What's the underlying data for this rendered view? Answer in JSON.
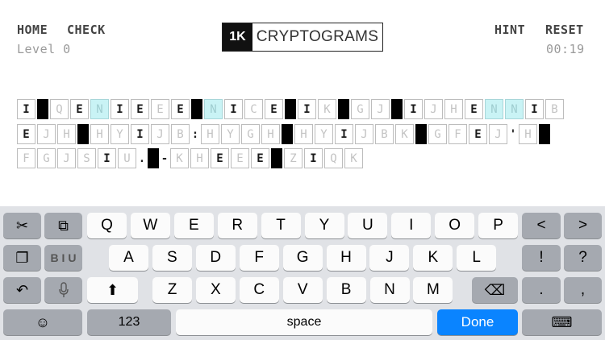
{
  "header": {
    "home_label": "HOME",
    "check_label": "CHECK",
    "level_label": "Level 0",
    "logo_mark": "1K",
    "logo_word": "CRYPTOGRAMS",
    "hint_label": "HINT",
    "reset_label": "RESET",
    "timer": "00:19"
  },
  "puzzle": {
    "rows": [
      [
        {
          "t": "I",
          "k": 1
        },
        {
          "b": 1
        },
        {
          "t": "Q"
        },
        {
          "t": "E",
          "k": 1
        },
        {
          "t": "N",
          "h": 1
        },
        {
          "t": "I",
          "k": 1
        },
        {
          "t": "E",
          "k": 1
        },
        {
          "t": "E"
        },
        {
          "t": "E",
          "k": 1
        },
        {
          "b": 1
        },
        {
          "t": "N",
          "h": 1
        },
        {
          "t": "I",
          "k": 1
        },
        {
          "t": "C"
        },
        {
          "t": "E",
          "k": 1
        },
        {
          "b": 1
        },
        {
          "t": "I",
          "k": 1
        },
        {
          "t": "K"
        },
        {
          "b": 1
        },
        {
          "t": "G"
        },
        {
          "t": "J"
        },
        {
          "b": 1
        },
        {
          "t": "I",
          "k": 1
        },
        {
          "t": "J"
        },
        {
          "t": "H"
        },
        {
          "t": "E",
          "k": 1
        },
        {
          "t": "N",
          "h": 1
        },
        {
          "t": "N",
          "h": 1
        },
        {
          "t": "I",
          "k": 1
        },
        {
          "t": "B"
        }
      ],
      [
        {
          "t": "E",
          "k": 1
        },
        {
          "t": "J"
        },
        {
          "t": "H"
        },
        {
          "b": 1
        },
        {
          "t": "H"
        },
        {
          "t": "Y"
        },
        {
          "t": "I",
          "k": 1
        },
        {
          "t": "J"
        },
        {
          "t": "B"
        },
        {
          "p": ":"
        },
        {
          "t": "H"
        },
        {
          "t": "Y"
        },
        {
          "t": "G"
        },
        {
          "t": "H"
        },
        {
          "b": 1
        },
        {
          "t": "H"
        },
        {
          "t": "Y"
        },
        {
          "t": "I",
          "k": 1
        },
        {
          "t": "J"
        },
        {
          "t": "B"
        },
        {
          "t": "K"
        },
        {
          "b": 1
        },
        {
          "t": "G"
        },
        {
          "t": "F"
        },
        {
          "t": "E",
          "k": 1
        },
        {
          "t": "J"
        },
        {
          "p": "'"
        },
        {
          "t": "H"
        },
        {
          "b": 1
        }
      ],
      [
        {
          "t": "F"
        },
        {
          "t": "G"
        },
        {
          "t": "J"
        },
        {
          "t": "S"
        },
        {
          "t": "I",
          "k": 1
        },
        {
          "t": "U"
        },
        {
          "p": "."
        },
        {
          "b": 1
        },
        {
          "p": "-"
        },
        {
          "t": "K"
        },
        {
          "t": "H"
        },
        {
          "t": "E",
          "k": 1
        },
        {
          "t": "E"
        },
        {
          "t": "E",
          "k": 1
        },
        {
          "b": 1
        },
        {
          "t": "Z"
        },
        {
          "t": "I",
          "k": 1
        },
        {
          "t": "Q"
        },
        {
          "t": "K"
        }
      ]
    ]
  },
  "keyboard": {
    "row1": [
      "Q",
      "W",
      "E",
      "R",
      "T",
      "Y",
      "U",
      "I",
      "O",
      "P"
    ],
    "row2": [
      "A",
      "S",
      "D",
      "F",
      "G",
      "H",
      "J",
      "K",
      "L"
    ],
    "row3": [
      "Z",
      "X",
      "C",
      "V",
      "B",
      "N",
      "M"
    ],
    "bold_italic_label": "B I U",
    "exclaim": "!",
    "question": "?",
    "period": ".",
    "comma": ",",
    "lt": "<",
    "gt": ">",
    "numbers_label": "123",
    "space_label": "space",
    "done_label": "Done",
    "icons": [
      "scissors-icon",
      "copy-icon",
      "paste-icon",
      "undo-icon",
      "mic-icon",
      "shift-icon",
      "backspace-icon",
      "emoji-icon",
      "keyboard-dismiss-icon"
    ],
    "colors": {
      "done": "#0a84ff",
      "background": "#e0e2e6",
      "highlight": "#c9f3f5"
    }
  }
}
